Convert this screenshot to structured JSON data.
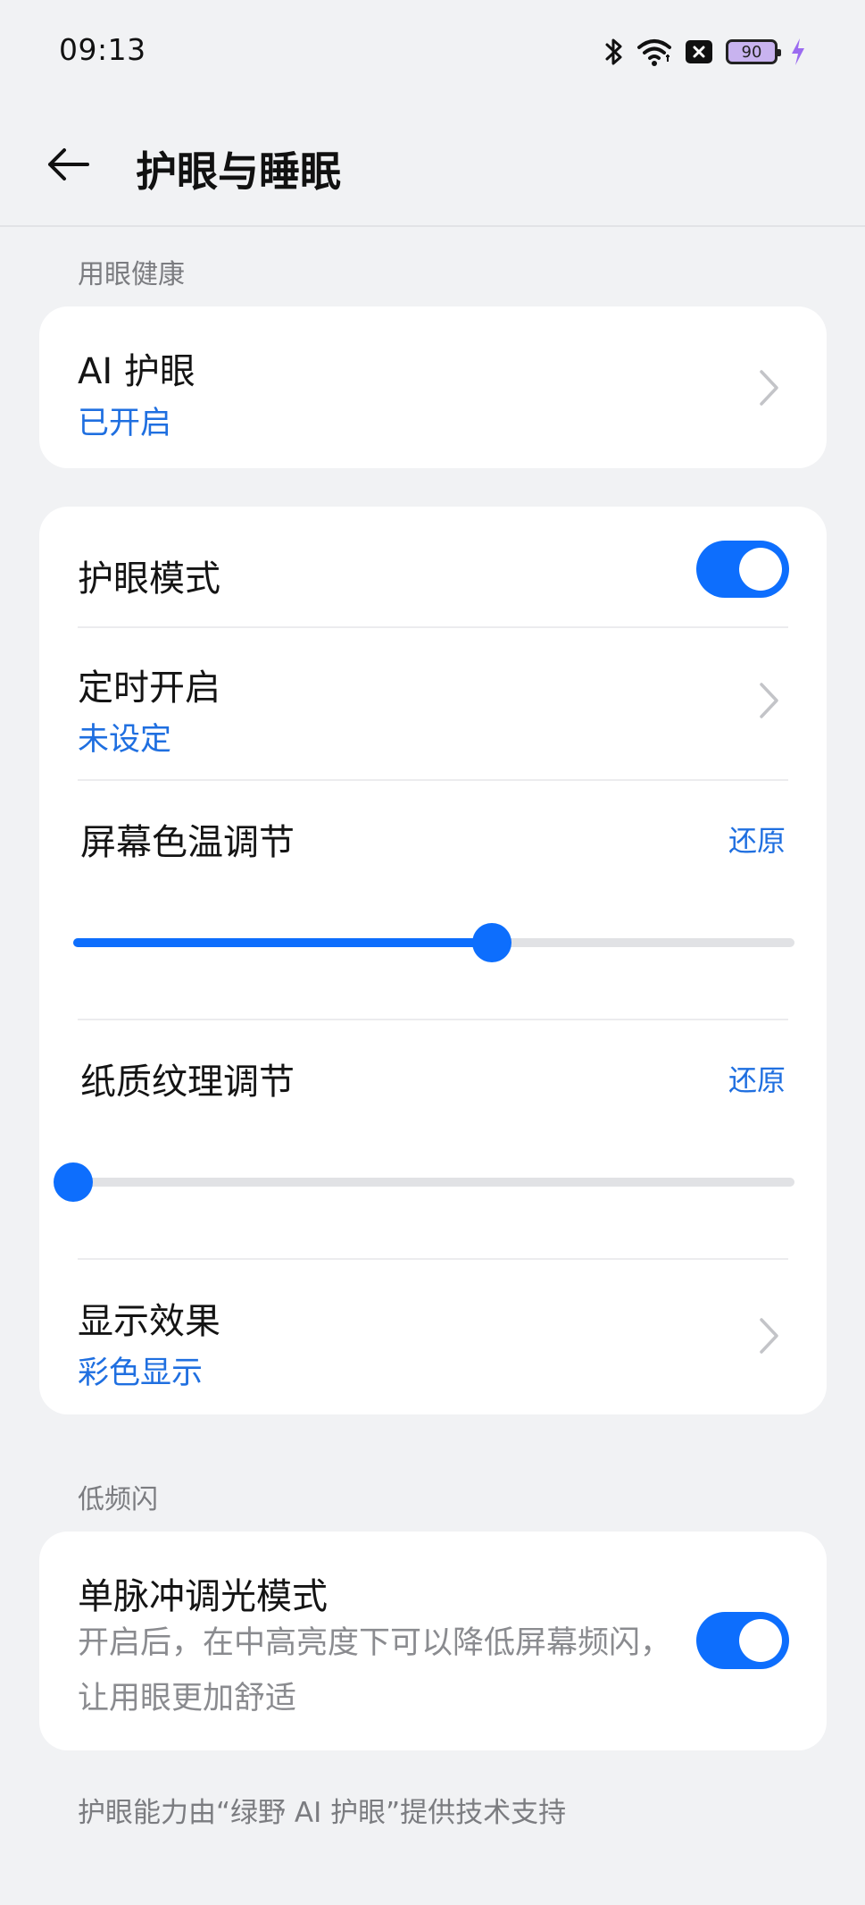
{
  "status_bar": {
    "time": "09:13",
    "battery_level": "90",
    "icons": [
      "bluetooth-icon",
      "wifi-icon",
      "sim-off-icon",
      "battery-icon",
      "charging-icon"
    ]
  },
  "header": {
    "title": "护眼与睡眠",
    "back_icon": "arrow-left-icon"
  },
  "sections": {
    "eye_health_label": "用眼健康",
    "low_flicker_label": "低频闪"
  },
  "ai_eye_care": {
    "title": "AI 护眼",
    "status": "已开启"
  },
  "eye_care_card": {
    "eye_mode": {
      "title": "护眼模式",
      "enabled": true
    },
    "schedule": {
      "title": "定时开启",
      "status": "未设定"
    },
    "color_temp": {
      "title": "屏幕色温调节",
      "restore": "还原",
      "value_fraction": 0.58
    },
    "paper_texture": {
      "title": "纸质纹理调节",
      "restore": "还原",
      "value_fraction": 0.0
    },
    "display_effect": {
      "title": "显示效果",
      "status": "彩色显示"
    }
  },
  "dc_dimming": {
    "title": "单脉冲调光模式",
    "description": "开启后，在中高亮度下可以降低屏幕频闪，让用眼更加舒适",
    "enabled": true
  },
  "footer": {
    "note": "护眼能力由“绿野 AI 护眼”提供技术支持"
  },
  "colors": {
    "accent": "#0d6efd",
    "link": "#1f6fe0",
    "background": "#f1f2f4",
    "card": "#ffffff"
  }
}
